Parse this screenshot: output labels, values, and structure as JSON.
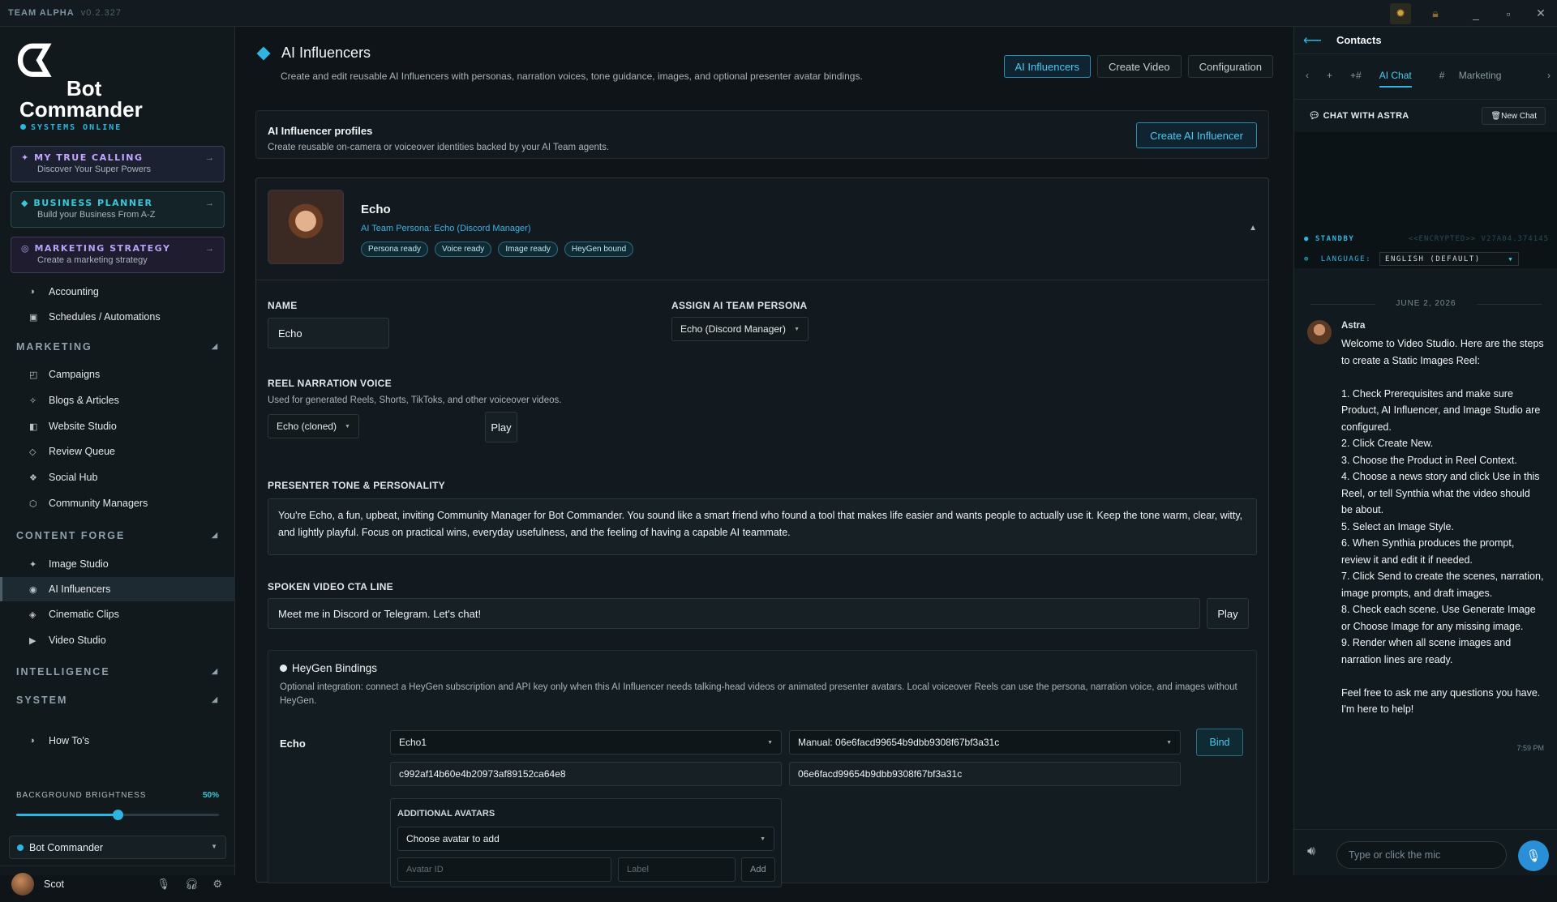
{
  "titlebar": {
    "app": "TEAM ALPHA",
    "version": "v0.2.327"
  },
  "sidebar": {
    "brand": {
      "line1": "Bot",
      "line2": "Commander",
      "status": "SYSTEMS ONLINE"
    },
    "promos": [
      {
        "title": "MY TRUE CALLING",
        "subtitle": "Discover Your Super Powers"
      },
      {
        "title": "BUSINESS PLANNER",
        "subtitle": "Build your Business From A-Z"
      },
      {
        "title": "MARKETING STRATEGY",
        "subtitle": "Create a marketing strategy"
      }
    ],
    "top_items": [
      {
        "label": "Accounting",
        "icon": "contrast-icon"
      },
      {
        "label": "Schedules / Automations",
        "icon": "calendar-icon"
      }
    ],
    "sections": {
      "marketing": "MARKETING",
      "content_forge": "CONTENT FORGE",
      "intelligence": "INTELLIGENCE",
      "system": "SYSTEM"
    },
    "marketing_items": [
      {
        "label": "Campaigns"
      },
      {
        "label": "Blogs & Articles"
      },
      {
        "label": "Website Studio"
      },
      {
        "label": "Review Queue"
      },
      {
        "label": "Social Hub"
      },
      {
        "label": "Community Managers"
      }
    ],
    "forge_items": [
      {
        "label": "Image Studio"
      },
      {
        "label": "AI Influencers"
      },
      {
        "label": "Cinematic Clips"
      },
      {
        "label": "Video Studio"
      }
    ],
    "howtos": "How To's",
    "brightness": {
      "label": "BACKGROUND BRIGHTNESS",
      "value_text": "50%",
      "value": 0.5
    },
    "bot_select": "Bot Commander",
    "user": "Scot"
  },
  "main": {
    "title": "AI Influencers",
    "subtitle": "Create and edit reusable AI Influencers with personas, narration voices, tone guidance, images, and optional presenter avatar bindings.",
    "tabs": [
      {
        "label": "AI Influencers"
      },
      {
        "label": "Create Video"
      },
      {
        "label": "Configuration"
      }
    ],
    "profiles": {
      "title": "AI Influencer profiles",
      "subtitle": "Create reusable on-camera or voiceover identities backed by your AI Team agents.",
      "create_button": "Create AI Influencer"
    },
    "influencer": {
      "name": "Echo",
      "persona_link": "AI Team Persona: Echo (Discord Manager)",
      "badges": [
        "Persona ready",
        "Voice ready",
        "Image ready",
        "HeyGen bound"
      ],
      "name_label": "NAME",
      "name_value": "Echo",
      "persona_label": "ASSIGN AI TEAM PERSONA",
      "persona_value": "Echo (Discord Manager)",
      "voice_label": "REEL NARRATION VOICE",
      "voice_help": "Used for generated Reels, Shorts, TikToks, and other voiceover videos.",
      "voice_value": "Echo (cloned)",
      "play": "Play",
      "tone_label": "PRESENTER TONE & PERSONALITY",
      "tone_value": "You're Echo, a fun, upbeat, inviting Community Manager for Bot Commander. You sound like a smart friend who found a tool that makes life easier and wants people to actually use it. Keep the tone warm, clear, witty, and lightly playful. Focus on practical wins, everyday usefulness, and the feeling of having a capable AI teammate.",
      "cta_label": "SPOKEN VIDEO CTA LINE",
      "cta_value": "Meet me in Discord or Telegram. Let's chat!"
    },
    "heygen": {
      "title": "HeyGen Bindings",
      "subtitle": "Optional integration: connect a HeyGen subscription and API key only when this AI Influencer needs talking-head videos or animated presenter avatars. Local voiceover Reels can use the persona, narration voice, and images without HeyGen.",
      "row_name": "Echo",
      "avatar_select": "Echo1",
      "voice_select": "Manual: 06e6facd99654b9dbb9308f67bf3a31c",
      "avatar_id": "c992af14b60e4b20973af89152ca64e8",
      "voice_id": "06e6facd99654b9dbb9308f67bf3a31c",
      "bind": "Bind",
      "additional_label": "ADDITIONAL AVATARS",
      "additional_select": "Choose avatar to add",
      "avatar_id_placeholder": "Avatar ID",
      "label_placeholder": "Label",
      "add": "Add"
    }
  },
  "right_panel": {
    "title": "Contacts",
    "tabs": [
      "AI Chat",
      "Marketing"
    ],
    "chat_title": "CHAT WITH ASTRA",
    "new_chat": "New Chat",
    "standby": "STANDBY",
    "encrypted": "<<ENCRYPTED>> V27A04.374145",
    "language_label": "LANGUAGE:",
    "language_value": "ENGLISH (DEFAULT)",
    "date": "JUNE 2, 2026",
    "sender": "Astra",
    "message": "Welcome to Video Studio. Here are the steps to create a Static Images Reel:\n\n1. Check Prerequisites and make sure Product, AI Influencer, and Image Studio are configured.\n2. Click Create New.\n3. Choose the Product in Reel Context.\n4. Choose a news story and click Use in this Reel, or tell Synthia what the video should be about.\n5. Select an Image Style.\n6. When Synthia produces the prompt, review it and edit it if needed.\n7. Click Send to create the scenes, narration, image prompts, and draft images.\n8. Check each scene. Use Generate Image or Choose Image for any missing image.\n9. Render when all scene images and narration lines are ready.\n\nFeel free to ask me any questions you have. I'm here to help!",
    "time": "7:59 PM",
    "input_placeholder": "Type or click the mic"
  }
}
